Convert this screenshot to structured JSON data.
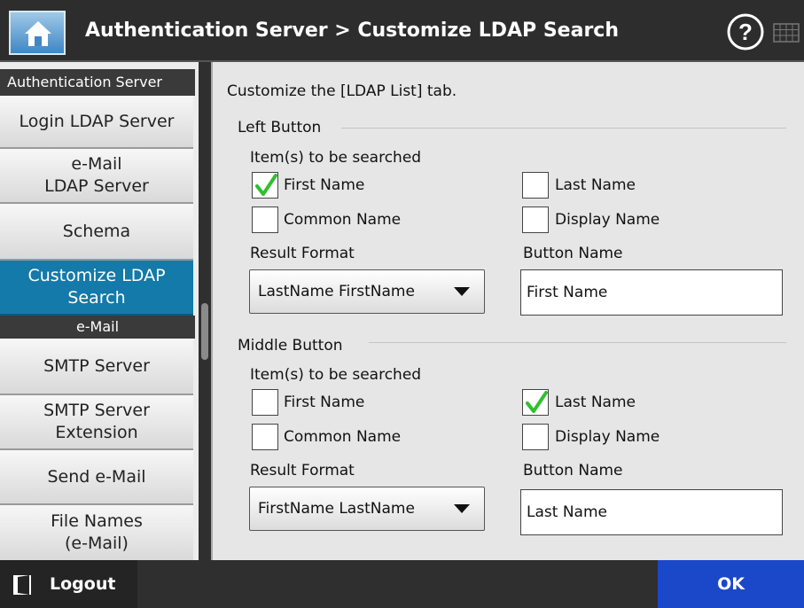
{
  "header": {
    "title": "Authentication Server > Customize LDAP Search",
    "home_icon": "home-icon",
    "help_icon": "help-icon",
    "keyboard_icon": "keyboard-icon"
  },
  "sidebar": {
    "sections": [
      {
        "header": "Authentication Server",
        "items": [
          {
            "label": "Login LDAP Server",
            "active": false
          },
          {
            "label": "e-Mail\nLDAP Server",
            "active": false
          },
          {
            "label": "Schema",
            "active": false
          },
          {
            "label": "Customize LDAP\nSearch",
            "active": true
          }
        ]
      },
      {
        "header": "e-Mail",
        "items": [
          {
            "label": "SMTP Server",
            "active": false
          },
          {
            "label": "SMTP Server\nExtension",
            "active": false
          },
          {
            "label": "Send e-Mail",
            "active": false
          },
          {
            "label": "File Names\n(e-Mail)",
            "active": false
          }
        ]
      }
    ]
  },
  "content": {
    "intro": "Customize the [LDAP List] tab.",
    "left_button": {
      "legend": "Left Button",
      "items_label": "Item(s) to be searched",
      "checkboxes": [
        {
          "label": "First Name",
          "checked": true
        },
        {
          "label": "Last Name",
          "checked": false
        },
        {
          "label": "Common Name",
          "checked": false
        },
        {
          "label": "Display Name",
          "checked": false
        }
      ],
      "result_format_label": "Result Format",
      "result_format_value": "LastName FirstName",
      "button_name_label": "Button Name",
      "button_name_value": "First Name"
    },
    "middle_button": {
      "legend": "Middle Button",
      "items_label": "Item(s) to be searched",
      "checkboxes": [
        {
          "label": "First Name",
          "checked": false
        },
        {
          "label": "Last Name",
          "checked": true
        },
        {
          "label": "Common Name",
          "checked": false
        },
        {
          "label": "Display Name",
          "checked": false
        }
      ],
      "result_format_label": "Result Format",
      "result_format_value": "FirstName LastName",
      "button_name_label": "Button Name",
      "button_name_value": "Last Name"
    }
  },
  "footer": {
    "logout_label": "Logout",
    "ok_label": "OK"
  },
  "colors": {
    "active_item": "#137aaa",
    "ok_button": "#1b47c9",
    "check_mark": "#2fc02f"
  }
}
